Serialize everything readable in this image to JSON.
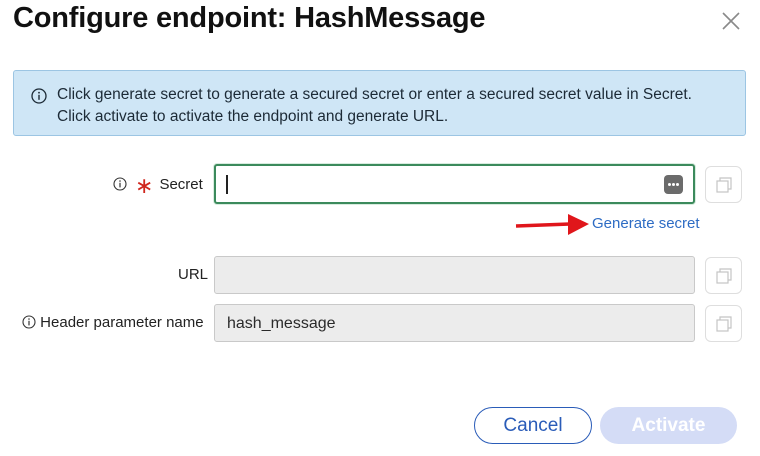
{
  "dialog": {
    "title": "Configure endpoint: HashMessage",
    "close_icon": "close-icon"
  },
  "banner": {
    "icon": "info-icon",
    "line1": "Click generate secret to generate a secured secret or enter a secured secret value in Secret.",
    "line2": "Click activate to activate the endpoint and generate URL."
  },
  "form": {
    "secret": {
      "label": "Secret",
      "required_marker": "∗",
      "value": "",
      "info_icon": "info-icon",
      "reveal_icon": "more-options-icon",
      "generate_link": "Generate secret"
    },
    "url": {
      "label": "URL",
      "value": ""
    },
    "header_param": {
      "label": "Header parameter name",
      "value": "hash_message",
      "info_icon": "info-icon"
    },
    "copy_icon": "copy-icon"
  },
  "footer": {
    "cancel_label": "Cancel",
    "activate_label": "Activate"
  },
  "colors": {
    "banner_bg": "#cfe6f6",
    "focus_border": "#3c8a5c",
    "link": "#2d6cc4",
    "primary_disabled": "#d4dcf6",
    "required": "#d0261d",
    "arrow": "#e0161b"
  }
}
